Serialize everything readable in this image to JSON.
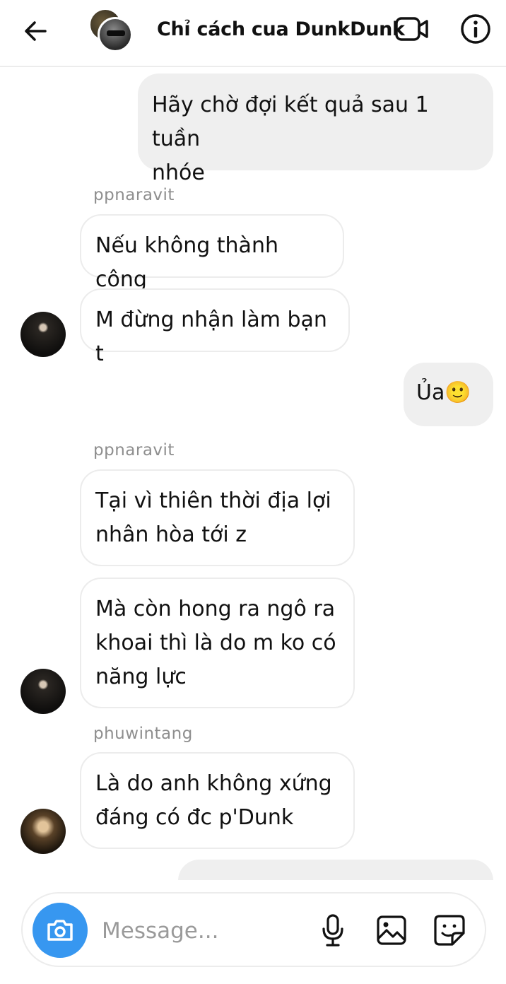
{
  "header": {
    "title": "Chỉ cách cua DunkDunk",
    "back_icon": "back-arrow-icon",
    "video_icon": "video-call-icon",
    "info_icon": "info-icon"
  },
  "messages": [
    {
      "direction": "outgoing",
      "lines": [
        "Hãy chờ đợi kết quả sau 1 tuần",
        "nhóe"
      ]
    },
    {
      "direction": "incoming",
      "sender": "ppnaravit",
      "lines": [
        "Nếu không thành công"
      ]
    },
    {
      "direction": "incoming",
      "lines": [
        "M đừng nhận làm bạn t"
      ]
    },
    {
      "direction": "outgoing",
      "lines": [
        "Ủa🙂"
      ]
    },
    {
      "direction": "incoming",
      "sender": "ppnaravit",
      "lines": [
        "Tại vì thiên thời địa lợi",
        "nhân hòa tới z"
      ]
    },
    {
      "direction": "incoming",
      "lines": [
        "Mà còn hong ra ngô ra",
        "khoai thì là do m ko có",
        "năng lực"
      ]
    },
    {
      "direction": "incoming",
      "sender": "phuwintang",
      "lines": [
        "Là do anh không xứng",
        "đáng có đc p'Dunk"
      ]
    }
  ],
  "composer": {
    "placeholder": "Message...",
    "camera_icon": "camera-icon",
    "mic_icon": "microphone-icon",
    "gallery_icon": "gallery-icon",
    "sticker_icon": "sticker-icon"
  },
  "colors": {
    "accent": "#3797f0",
    "outgoing_bubble": "#efefef",
    "incoming_border": "#ececec",
    "sender_text": "#8e8e8e"
  }
}
